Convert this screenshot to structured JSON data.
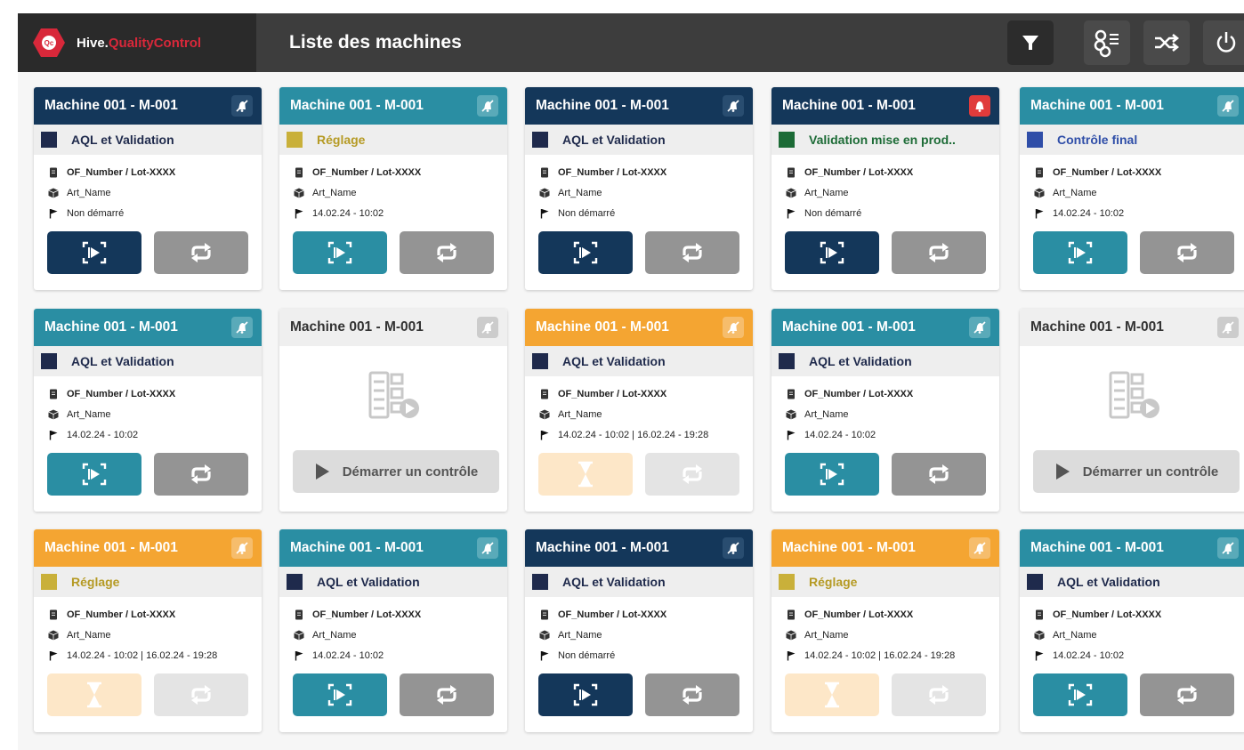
{
  "app": {
    "brand_name": "Hive.",
    "brand_accent": "QualityControl",
    "logo_text": "Qc",
    "page_title": "Liste des machines"
  },
  "toolbar": {
    "buttons": [
      {
        "name": "filter-button",
        "icon": "filter-icon"
      },
      {
        "name": "settings-button",
        "icon": "gears-list-icon"
      },
      {
        "name": "shuffle-button",
        "icon": "shuffle-icon"
      },
      {
        "name": "power-button",
        "icon": "power-icon"
      }
    ]
  },
  "colors": {
    "navy": "#14375a",
    "teal": "#2a8ea3",
    "orange": "#f4a532",
    "grey": "#949494",
    "alert_red": "#e03b3b",
    "step_navy": "#1f2a4c",
    "step_olive": "#c9b03a",
    "step_green": "#1c6b36",
    "step_blue": "#2f4ea8"
  },
  "cards": [
    {
      "machine": "Machine 001 -  M-001",
      "header": "navy",
      "badge": "bell-off",
      "step": "AQL et Validation",
      "step_color": "#1f2a4c",
      "step_text_color": "#1f2a4c",
      "of": "OF_Number / Lot-XXXX",
      "art": "Art_Name",
      "date": "Non démarré",
      "primary": "navy",
      "secondary": "grey",
      "state": "active"
    },
    {
      "machine": "Machine 001 -  M-001",
      "header": "teal",
      "badge": "bell-off",
      "step": "Réglage",
      "step_color": "#c9b03a",
      "step_text_color": "#b59a24",
      "of": "OF_Number / Lot-XXXX",
      "art": "Art_Name",
      "date": "14.02.24 - 10:02",
      "primary": "teal",
      "secondary": "grey",
      "state": "active"
    },
    {
      "machine": "Machine 001 -  M-001",
      "header": "navy",
      "badge": "bell-off",
      "step": "AQL et Validation",
      "step_color": "#1f2a4c",
      "step_text_color": "#1f2a4c",
      "of": "OF_Number / Lot-XXXX",
      "art": "Art_Name",
      "date": "Non démarré",
      "primary": "navy",
      "secondary": "grey",
      "state": "active"
    },
    {
      "machine": "Machine 001 -  M-001",
      "header": "navy",
      "badge": "bell-alert",
      "step": "Validation mise en prod..",
      "step_color": "#1c6b36",
      "step_text_color": "#1c6b36",
      "of": "OF_Number / Lot-XXXX",
      "art": "Art_Name",
      "date": "Non démarré",
      "primary": "navy",
      "secondary": "grey",
      "state": "active"
    },
    {
      "machine": "Machine 001 -  M-001",
      "header": "teal",
      "badge": "bell-off",
      "step": "Contrôle final",
      "step_color": "#2f4ea8",
      "step_text_color": "#2f4ea8",
      "of": "OF_Number / Lot-XXXX",
      "art": "Art_Name",
      "date": "14.02.24 - 10:02",
      "primary": "teal",
      "secondary": "grey",
      "state": "active"
    },
    {
      "machine": "Machine 001 -  M-001",
      "header": "teal",
      "badge": "bell-off",
      "step": "AQL et Validation",
      "step_color": "#1f2a4c",
      "step_text_color": "#1f2a4c",
      "of": "OF_Number / Lot-XXXX",
      "art": "Art_Name",
      "date": "14.02.24 - 10:02",
      "primary": "teal",
      "secondary": "grey",
      "state": "active"
    },
    {
      "machine": "Machine 001 -  M-001",
      "header": "grey",
      "badge": "bell-off",
      "state": "empty",
      "start_label": "Démarrer un contrôle"
    },
    {
      "machine": "Machine 001 -  M-001",
      "header": "orange",
      "badge": "bell-off",
      "step": "AQL et Validation",
      "step_color": "#1f2a4c",
      "step_text_color": "#1f2a4c",
      "of": "OF_Number / Lot-XXXX",
      "art": "Art_Name",
      "date": "14.02.24 - 10:02  |  16.02.24 - 19:28",
      "primary": "peach",
      "secondary": "lightgrey",
      "state": "waiting"
    },
    {
      "machine": "Machine 001 -  M-001",
      "header": "teal",
      "badge": "bell-off",
      "step": "AQL et Validation",
      "step_color": "#1f2a4c",
      "step_text_color": "#1f2a4c",
      "of": "OF_Number / Lot-XXXX",
      "art": "Art_Name",
      "date": "14.02.24 - 10:02",
      "primary": "teal",
      "secondary": "grey",
      "state": "active"
    },
    {
      "machine": "Machine 001 -  M-001",
      "header": "grey",
      "badge": "bell-off",
      "state": "empty",
      "start_label": "Démarrer un contrôle"
    },
    {
      "machine": "Machine 001 -  M-001",
      "header": "orange",
      "badge": "bell-off",
      "step": "Réglage",
      "step_color": "#c9b03a",
      "step_text_color": "#b59a24",
      "of": "OF_Number / Lot-XXXX",
      "art": "Art_Name",
      "date": "14.02.24 - 10:02  |  16.02.24 - 19:28",
      "primary": "peach",
      "secondary": "lightgrey",
      "state": "waiting"
    },
    {
      "machine": "Machine 001 -  M-001",
      "header": "teal",
      "badge": "bell-off",
      "step": "AQL et Validation",
      "step_color": "#1f2a4c",
      "step_text_color": "#1f2a4c",
      "of": "OF_Number / Lot-XXXX",
      "art": "Art_Name",
      "date": "14.02.24 - 10:02",
      "primary": "teal",
      "secondary": "grey",
      "state": "active"
    },
    {
      "machine": "Machine 001 -  M-001",
      "header": "navy",
      "badge": "bell-off",
      "step": "AQL et Validation",
      "step_color": "#1f2a4c",
      "step_text_color": "#1f2a4c",
      "of": "OF_Number / Lot-XXXX",
      "art": "Art_Name",
      "date": "Non démarré",
      "primary": "navy",
      "secondary": "grey",
      "state": "active"
    },
    {
      "machine": "Machine 001 -  M-001",
      "header": "orange",
      "badge": "bell-off",
      "step": "Réglage",
      "step_color": "#c9b03a",
      "step_text_color": "#b59a24",
      "of": "OF_Number / Lot-XXXX",
      "art": "Art_Name",
      "date": "14.02.24 - 10:02  |  16.02.24 - 19:28",
      "primary": "peach",
      "secondary": "lightgrey",
      "state": "waiting"
    },
    {
      "machine": "Machine 001 -  M-001",
      "header": "teal",
      "badge": "bell-off",
      "step": "AQL et Validation",
      "step_color": "#1f2a4c",
      "step_text_color": "#1f2a4c",
      "of": "OF_Number / Lot-XXXX",
      "art": "Art_Name",
      "date": "14.02.24 - 10:02",
      "primary": "teal",
      "secondary": "grey",
      "state": "active"
    }
  ]
}
